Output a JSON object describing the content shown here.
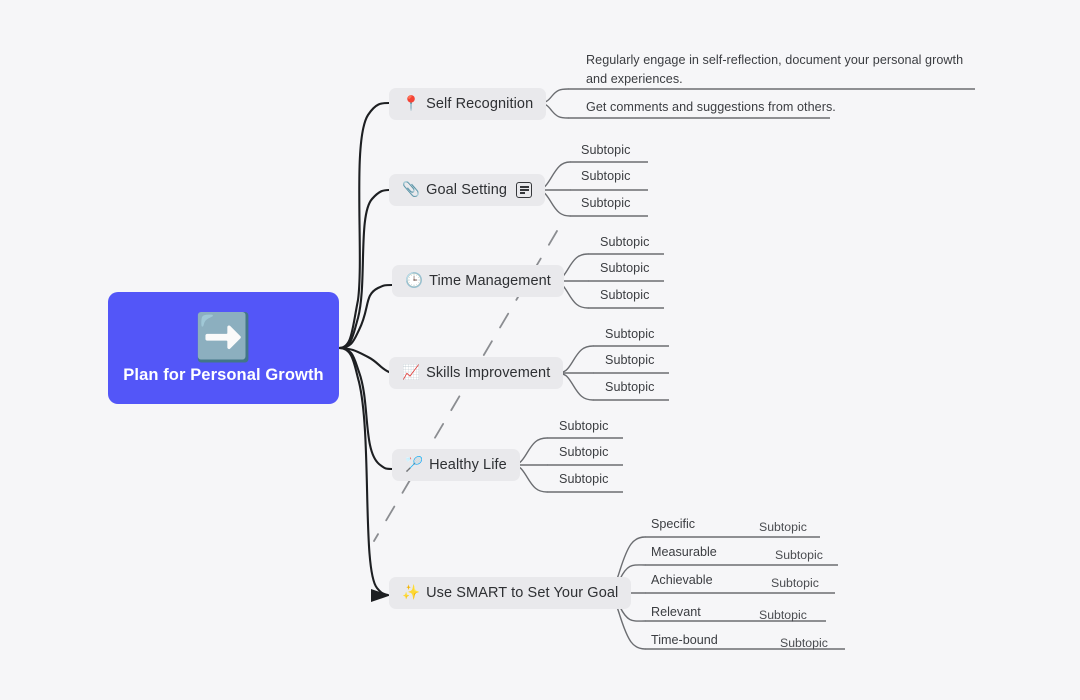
{
  "document": {
    "type": "mind-map",
    "background_color": "#f6f6f8"
  },
  "root": {
    "label": "Plan for Personal Growth",
    "emoji": "➡️",
    "emoji_name": "curved-arrow-right-icon",
    "background_color": "#5356f8",
    "text_color": "#ffffff"
  },
  "branches": [
    {
      "id": "self-recognition",
      "label": "Self Recognition",
      "emoji": "📍",
      "emoji_name": "round-pushpin-icon",
      "children": [
        {
          "label": "Regularly engage in self-reflection, document your personal growth and experiences."
        },
        {
          "label": "Get comments and suggestions from others."
        }
      ]
    },
    {
      "id": "goal-setting",
      "label": "Goal Setting",
      "emoji": "📎",
      "emoji_name": "paperclip-icon",
      "badge": "note-icon",
      "children": [
        {
          "label": "Subtopic"
        },
        {
          "label": "Subtopic"
        },
        {
          "label": "Subtopic"
        }
      ]
    },
    {
      "id": "time-management",
      "label": "Time Management",
      "emoji": "🕒",
      "emoji_name": "clock-icon",
      "children": [
        {
          "label": "Subtopic"
        },
        {
          "label": "Subtopic"
        },
        {
          "label": "Subtopic"
        }
      ]
    },
    {
      "id": "skills-improvement",
      "label": "Skills Improvement",
      "emoji": "📈",
      "emoji_name": "chart-increasing-icon",
      "children": [
        {
          "label": "Subtopic"
        },
        {
          "label": "Subtopic"
        },
        {
          "label": "Subtopic"
        }
      ]
    },
    {
      "id": "healthy-life",
      "label": "Healthy Life",
      "emoji": "🏸",
      "emoji_name": "badminton-icon",
      "children": [
        {
          "label": "Subtopic"
        },
        {
          "label": "Subtopic"
        },
        {
          "label": "Subtopic"
        }
      ]
    },
    {
      "id": "use-smart",
      "label": "Use SMART to Set Your Goal",
      "emoji": "✨",
      "emoji_name": "sparkles-icon",
      "children": [
        {
          "label": "Specific",
          "sub": "Subtopic"
        },
        {
          "label": "Measurable",
          "sub": "Subtopic"
        },
        {
          "label": "Achievable",
          "sub": "Subtopic"
        },
        {
          "label": "Relevant",
          "sub": "Subtopic"
        },
        {
          "label": "Time-bound",
          "sub": "Subtopic"
        }
      ]
    }
  ]
}
